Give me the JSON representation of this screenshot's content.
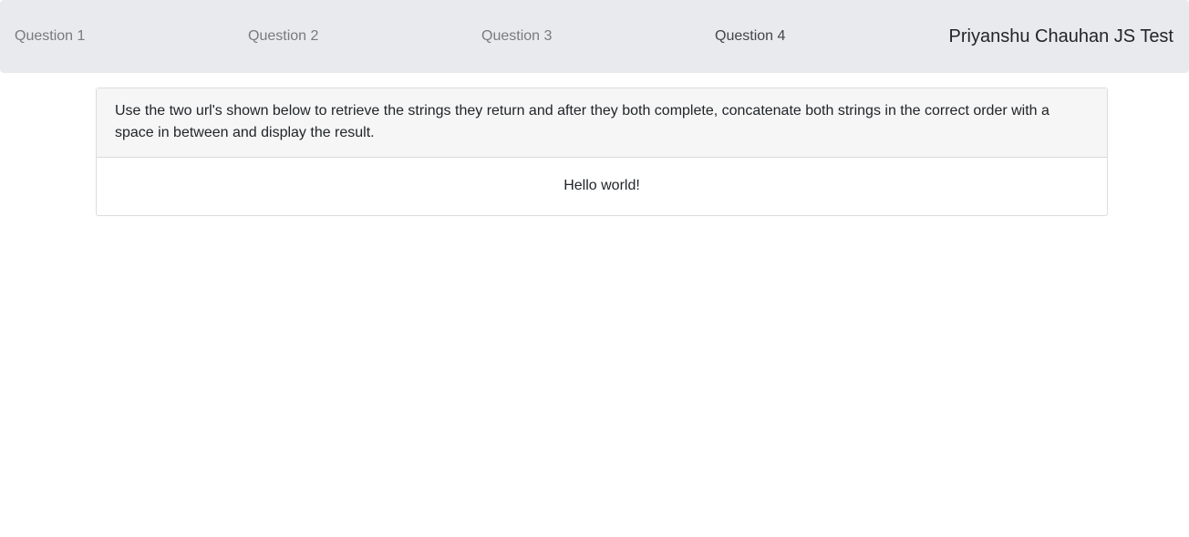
{
  "nav": {
    "items": [
      {
        "label": "Question 1"
      },
      {
        "label": "Question 2"
      },
      {
        "label": "Question 3"
      },
      {
        "label": "Question 4"
      }
    ],
    "brand": "Priyanshu Chauhan JS Test"
  },
  "card": {
    "instructions": "Use the two url's shown below to retrieve the strings they return and after they both complete, concatenate both strings in the correct order with a space in between and display the result.",
    "result": "Hello world!"
  }
}
